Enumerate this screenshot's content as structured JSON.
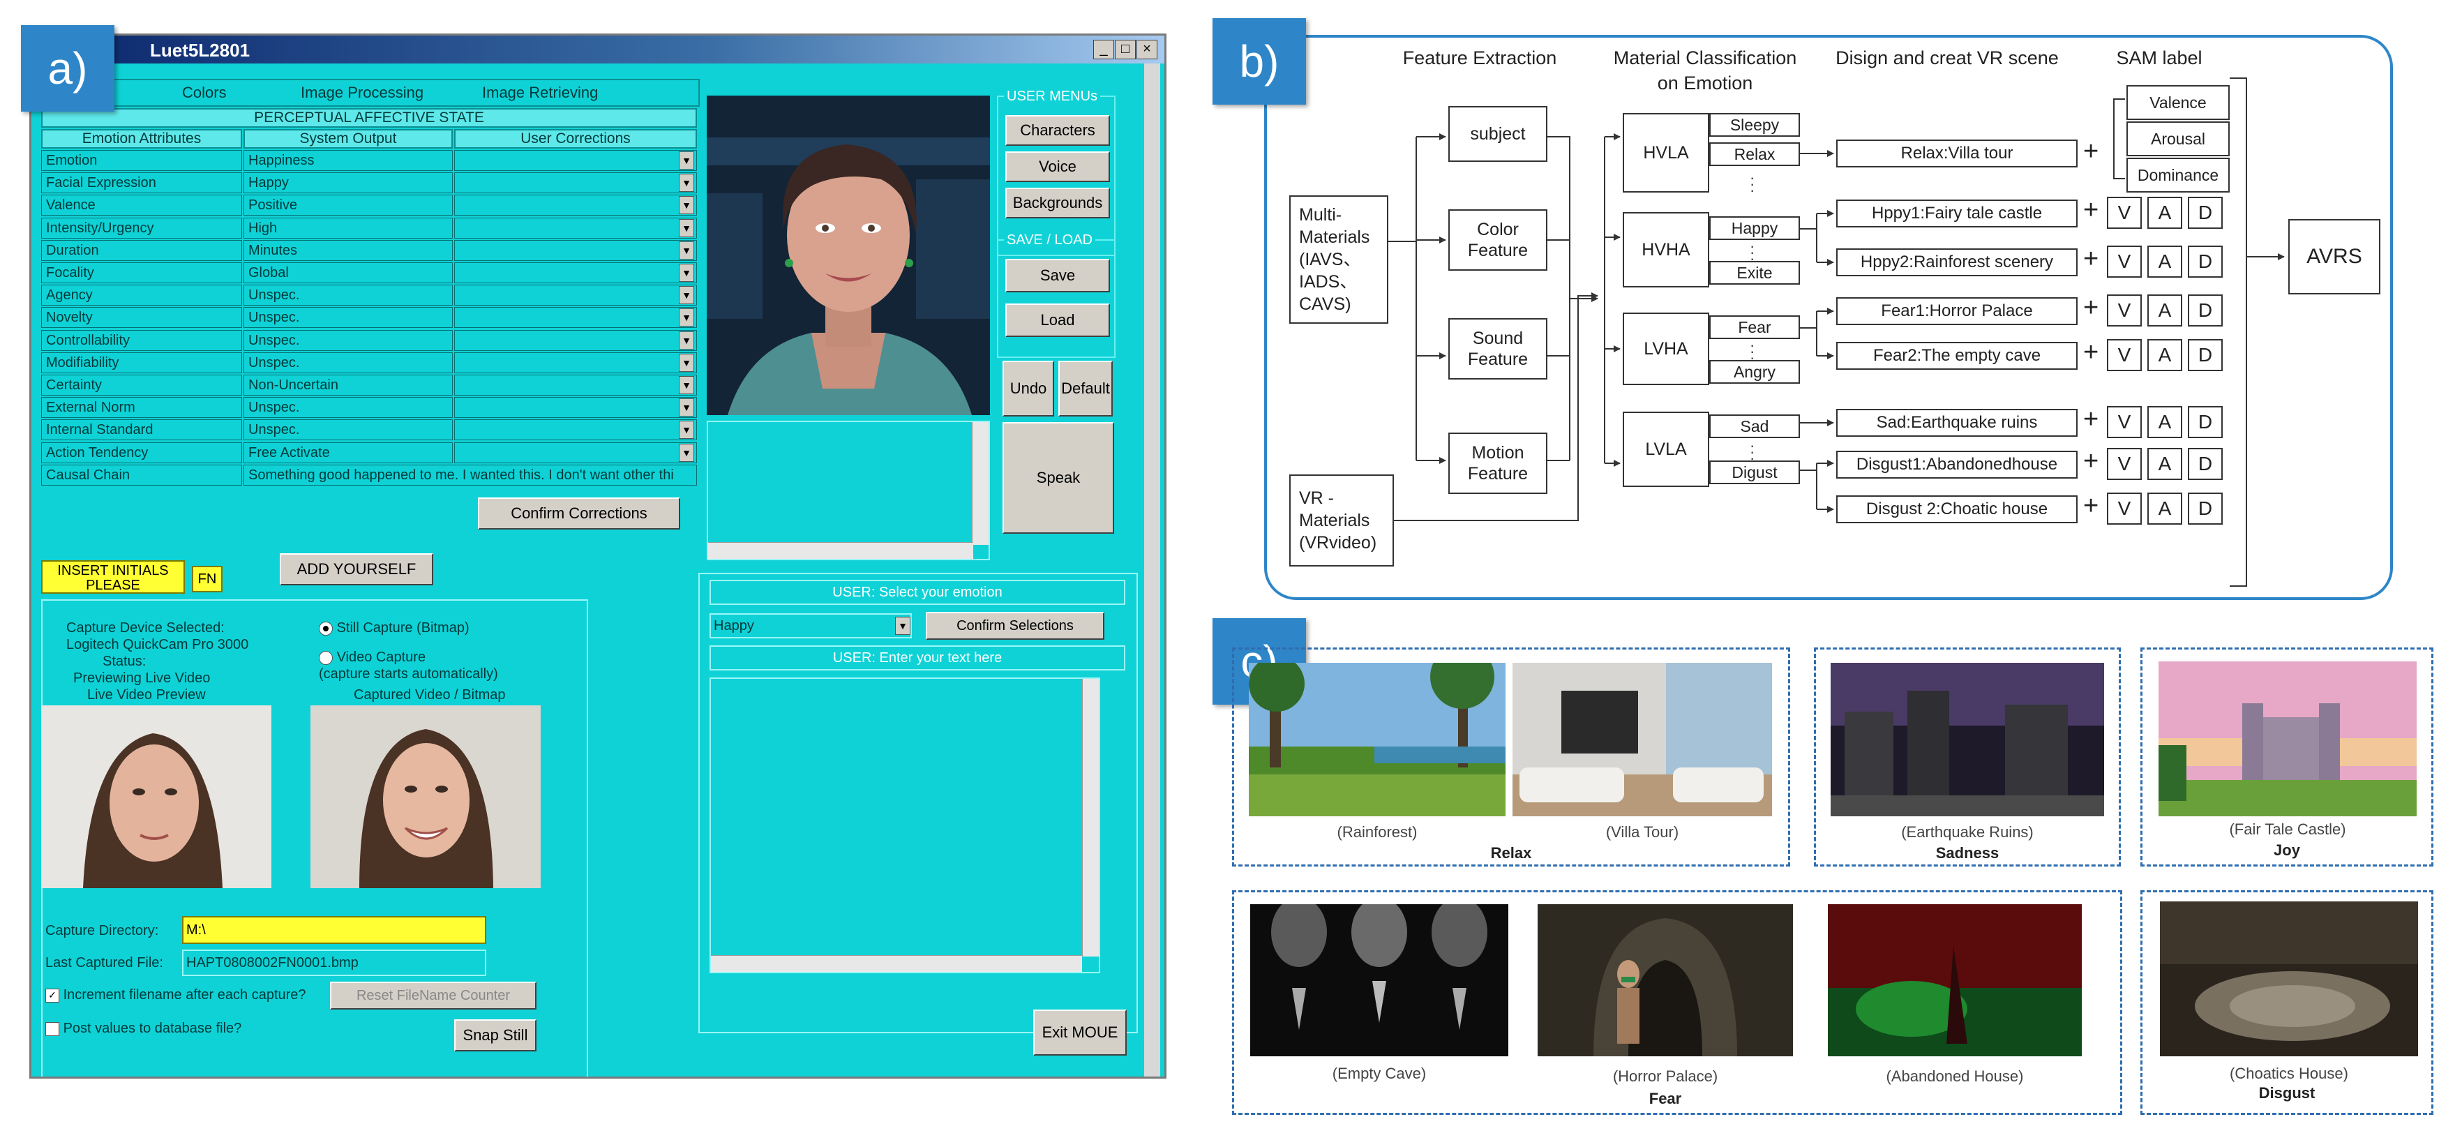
{
  "panels": {
    "a": "a)",
    "b": "b)",
    "c": "c)"
  },
  "window": {
    "title": "Luet5L2801",
    "controls": [
      "_",
      "□",
      "×"
    ],
    "tabs": [
      "Colors",
      "Image Processing",
      "Image Retrieving"
    ],
    "section_title": "PERCEPTUAL AFFECTIVE STATE",
    "columns": [
      "Emotion Attributes",
      "System Output",
      "User Corrections"
    ],
    "rows": [
      {
        "attr": "Emotion",
        "output": "Happiness"
      },
      {
        "attr": "Facial Expression",
        "output": "Happy"
      },
      {
        "attr": "Valence",
        "output": "Positive"
      },
      {
        "attr": "Intensity/Urgency",
        "output": "High"
      },
      {
        "attr": "Duration",
        "output": "Minutes"
      },
      {
        "attr": "Focality",
        "output": "Global"
      },
      {
        "attr": "Agency",
        "output": "Unspec."
      },
      {
        "attr": "Novelty",
        "output": "Unspec."
      },
      {
        "attr": "Controllability",
        "output": "Unspec."
      },
      {
        "attr": "Modifiability",
        "output": "Unspec."
      },
      {
        "attr": "Certainty",
        "output": "Non-Uncertain"
      },
      {
        "attr": "External Norm",
        "output": "Unspec."
      },
      {
        "attr": "Internal Standard",
        "output": "Unspec."
      },
      {
        "attr": "Action Tendency",
        "output": "Free Activate"
      },
      {
        "attr": "Causal Chain",
        "output": "Something good happened to me. I wanted this. I don't want other thi"
      }
    ],
    "confirm_corrections": "Confirm Corrections",
    "user_menu": {
      "title": "USER MENUs",
      "characters": "Characters",
      "voice": "Voice",
      "backgrounds": "Backgrounds"
    },
    "save_load": {
      "title": "SAVE / LOAD",
      "save": "Save",
      "load": "Load"
    },
    "undo": "Undo",
    "default": "Default",
    "speak": "Speak",
    "insert_initials": "INSERT INITIALS PLEASE",
    "initials_value": "FN",
    "add_yourself": "ADD YOURSELF",
    "capture": {
      "device_label": "Capture Device Selected:",
      "device_name": "Logitech QuickCam Pro 3000",
      "status_label": "Status:",
      "status_value": "Previewing Live Video",
      "live_preview": "Live Video Preview",
      "still_capture": "Still Capture (Bitmap)",
      "video_capture": "Video Capture",
      "capture_note": "(capture starts automatically)",
      "captured_label": "Captured Video / Bitmap",
      "directory_label": "Capture Directory:",
      "directory_value": "M:\\",
      "last_file_label": "Last Captured File:",
      "last_file_value": "HAPT0808002FN0001.bmp",
      "increment_label": "Increment filename after each capture?",
      "reset_button": "Reset FileName Counter",
      "post_values_label": "Post values to database file?",
      "snap_button": "Snap Still"
    },
    "user_select": {
      "title": "USER: Select your emotion",
      "value": "Happy",
      "confirm": "Confirm Selections",
      "enter_text": "USER: Enter your text here"
    },
    "exit": "Exit MOUE"
  },
  "diagram": {
    "headers": {
      "feature": "Feature  Extraction",
      "material_1": "Material Classification",
      "material_2": "on Emotion",
      "design": "Disign and creat VR scene",
      "sam": "SAM label"
    },
    "multi": [
      "Multi-",
      "Materials",
      "(IAVS、",
      "IADS、",
      "CAVS)"
    ],
    "vr": [
      "VR -",
      "Materials",
      "(VRvideo)"
    ],
    "features": {
      "subject": "subject",
      "color": [
        "Color",
        "Feature"
      ],
      "sound": [
        "Sound",
        "Feature"
      ],
      "motion": [
        "Motion",
        "Feature"
      ]
    },
    "quadrants": {
      "hvla": {
        "name": "HVLA",
        "subs": [
          "Sleepy",
          "Relax"
        ]
      },
      "hvha": {
        "name": "HVHA",
        "subs": [
          "Happy",
          "Exite"
        ]
      },
      "lvha": {
        "name": "LVHA",
        "subs": [
          "Fear",
          "Angry"
        ]
      },
      "lvla": {
        "name": "LVLA",
        "subs": [
          "Sad",
          "Digust"
        ]
      }
    },
    "scenes": [
      "Relax:Villa tour",
      "Hppy1:Fairy tale castle",
      "Hppy2:Rainforest scenery",
      "Fear1:Horror Palace",
      "Fear2:The empty cave",
      "Sad:Earthquake ruins",
      "Disgust1:Abandonedhouse",
      "Disgust 2:Choatic house"
    ],
    "sam": [
      "Valence",
      "Arousal",
      "Dominance"
    ],
    "vad": [
      "V",
      "A",
      "D"
    ],
    "plus": "+",
    "output": "AVRS"
  },
  "scenes_panel": {
    "captions": {
      "rainforest": "(Rainforest)",
      "villa": "(Villa Tour)",
      "earthquake": "(Earthquake Ruins)",
      "castle": "(Fair Tale Castle)",
      "cave": "(Empty Cave)",
      "palace": "(Horror Palace)",
      "abandoned": "(Abandoned House)",
      "choatic": "(Choatics House)"
    },
    "categories": {
      "relax": "Relax",
      "sadness": "Sadness",
      "joy": "Joy",
      "fear": "Fear",
      "disgust": "Disgust"
    }
  }
}
